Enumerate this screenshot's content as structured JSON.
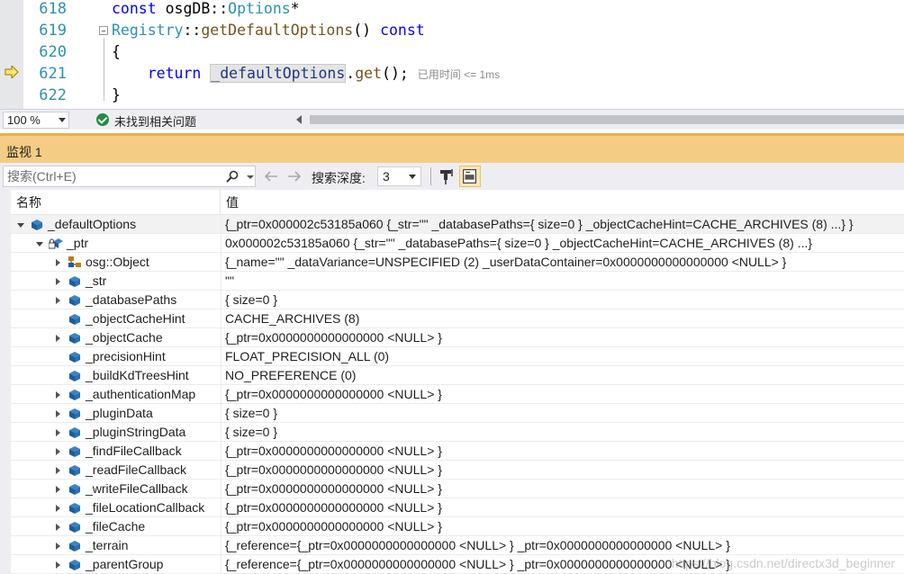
{
  "editor": {
    "lines": [
      {
        "no": "618",
        "parts": [
          {
            "t": "const ",
            "c": "kw"
          },
          {
            "t": "osgDB",
            "c": ""
          },
          {
            "t": "::",
            "c": ""
          },
          {
            "t": "Options",
            "c": "ty"
          },
          {
            "t": "*",
            "c": ""
          }
        ]
      },
      {
        "no": "619",
        "parts": [
          {
            "t": "Registry",
            "c": "ty"
          },
          {
            "t": "::",
            "c": ""
          },
          {
            "t": "getDefaultOptions",
            "c": "fn"
          },
          {
            "t": "() ",
            "c": ""
          },
          {
            "t": "const",
            "c": "kw"
          }
        ]
      },
      {
        "no": "620",
        "parts": [
          {
            "t": "{",
            "c": ""
          }
        ]
      },
      {
        "no": "621",
        "parts": [
          {
            "t": "    return ",
            "c": "kw"
          },
          {
            "t": "_defaultOptions",
            "c": "mem"
          },
          {
            "t": ".",
            "c": ""
          },
          {
            "t": "get",
            "c": "fn"
          },
          {
            "t": "(); ",
            "c": ""
          }
        ]
      },
      {
        "no": "622",
        "parts": [
          {
            "t": "}",
            "c": ""
          }
        ]
      }
    ],
    "perf_tip": "已用时间 <= 1ms"
  },
  "statusbar": {
    "zoom": "100 %",
    "issues": "未找到相关问题"
  },
  "watch": {
    "title": "监视 1",
    "search_placeholder": "搜索(Ctrl+E)",
    "depth_label": "搜索深度:",
    "depth_value": "3",
    "col_name": "名称",
    "col_value": "值",
    "rows": [
      {
        "level": 0,
        "exp": "expanded",
        "icon": "watch",
        "name": "_defaultOptions",
        "value": "{_ptr=0x000002c53185a060 {_str=\"\" _databasePaths={ size=0 } _objectCacheHint=CACHE_ARCHIVES (8) ...} }",
        "selected": true
      },
      {
        "level": 1,
        "exp": "expanded",
        "icon": "lock",
        "name": "_ptr",
        "value": "0x000002c53185a060 {_str=\"\" _databasePaths={ size=0 } _objectCacheHint=CACHE_ARCHIVES (8) ...}"
      },
      {
        "level": 2,
        "exp": "collapsed",
        "icon": "base",
        "name": "osg::Object",
        "value": "{_name=\"\" _dataVariance=UNSPECIFIED (2) _userDataContainer=0x0000000000000000 <NULL> }"
      },
      {
        "level": 2,
        "exp": "collapsed",
        "icon": "field",
        "name": "_str",
        "value": "\"\""
      },
      {
        "level": 2,
        "exp": "collapsed",
        "icon": "field",
        "name": "_databasePaths",
        "value": "{ size=0 }"
      },
      {
        "level": 2,
        "exp": "none",
        "icon": "field",
        "name": "_objectCacheHint",
        "value": "CACHE_ARCHIVES (8)"
      },
      {
        "level": 2,
        "exp": "collapsed",
        "icon": "field",
        "name": "_objectCache",
        "value": "{_ptr=0x0000000000000000 <NULL> }"
      },
      {
        "level": 2,
        "exp": "none",
        "icon": "field",
        "name": "_precisionHint",
        "value": "FLOAT_PRECISION_ALL (0)"
      },
      {
        "level": 2,
        "exp": "none",
        "icon": "field",
        "name": "_buildKdTreesHint",
        "value": "NO_PREFERENCE (0)"
      },
      {
        "level": 2,
        "exp": "collapsed",
        "icon": "field",
        "name": "_authenticationMap",
        "value": "{_ptr=0x0000000000000000 <NULL> }"
      },
      {
        "level": 2,
        "exp": "collapsed",
        "icon": "field",
        "name": "_pluginData",
        "value": "{ size=0 }"
      },
      {
        "level": 2,
        "exp": "collapsed",
        "icon": "field",
        "name": "_pluginStringData",
        "value": "{ size=0 }"
      },
      {
        "level": 2,
        "exp": "collapsed",
        "icon": "field",
        "name": "_findFileCallback",
        "value": "{_ptr=0x0000000000000000 <NULL> }"
      },
      {
        "level": 2,
        "exp": "collapsed",
        "icon": "field",
        "name": "_readFileCallback",
        "value": "{_ptr=0x0000000000000000 <NULL> }"
      },
      {
        "level": 2,
        "exp": "collapsed",
        "icon": "field",
        "name": "_writeFileCallback",
        "value": "{_ptr=0x0000000000000000 <NULL> }"
      },
      {
        "level": 2,
        "exp": "collapsed",
        "icon": "field",
        "name": "_fileLocationCallback",
        "value": "{_ptr=0x0000000000000000 <NULL> }"
      },
      {
        "level": 2,
        "exp": "collapsed",
        "icon": "field",
        "name": "_fileCache",
        "value": "{_ptr=0x0000000000000000 <NULL> }"
      },
      {
        "level": 2,
        "exp": "collapsed",
        "icon": "field",
        "name": "_terrain",
        "value": "{_reference={_ptr=0x0000000000000000 <NULL> } _ptr=0x0000000000000000 <NULL> }"
      },
      {
        "level": 2,
        "exp": "collapsed",
        "icon": "field",
        "name": "_parentGroup",
        "value": "{_reference={_ptr=0x0000000000000000 <NULL> } _ptr=0x0000000000000000 <NULL> }"
      }
    ]
  },
  "watermark": "https://blog.csdn.net/directx3d_beginner",
  "colors": {
    "keyword": "#0000ff",
    "type": "#2b91af",
    "function": "#74531f",
    "watch_header": "#f5cc84",
    "success": "#1e8e3e"
  }
}
